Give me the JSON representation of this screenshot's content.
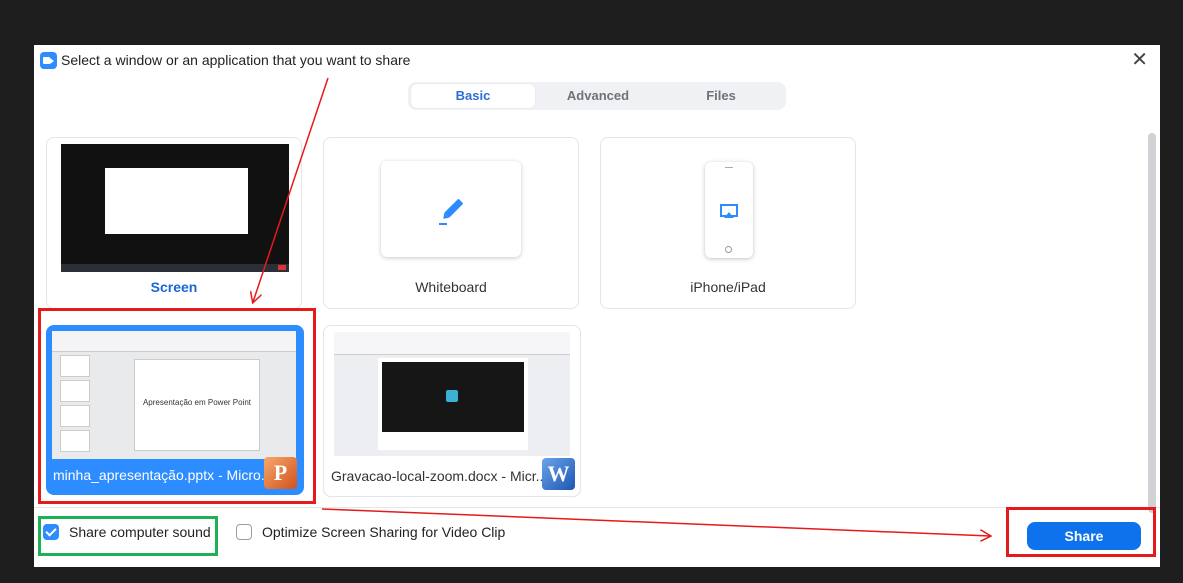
{
  "dialog": {
    "title": "Select a window or an application that you want to share",
    "close_glyph": "✕"
  },
  "tabs": [
    {
      "label": "Basic",
      "active": true
    },
    {
      "label": "Advanced",
      "active": false
    },
    {
      "label": "Files",
      "active": false
    }
  ],
  "tiles": {
    "screen": {
      "label": "Screen"
    },
    "whiteboard": {
      "label": "Whiteboard"
    },
    "iphone": {
      "label": "iPhone/iPad"
    },
    "ppt": {
      "label": "minha_apresentação.pptx - Micro...",
      "slide_text": "Apresentação em Power Point",
      "badge": "P",
      "selected": true
    },
    "word": {
      "label": "Gravacao-local-zoom.docx - Micr...",
      "badge": "W"
    }
  },
  "options": {
    "share_sound": {
      "label": "Share computer sound",
      "checked": true
    },
    "optimize_video": {
      "label": "Optimize Screen Sharing for Video Clip",
      "checked": false
    }
  },
  "share_button": {
    "label": "Share"
  },
  "colors": {
    "accent": "#2d8cff",
    "annotation_red": "#e41b1b",
    "annotation_green": "#1db054"
  },
  "icons": {
    "app": "zoom-camera-icon",
    "whiteboard": "pen-icon",
    "iphone": "airplay-icon"
  }
}
